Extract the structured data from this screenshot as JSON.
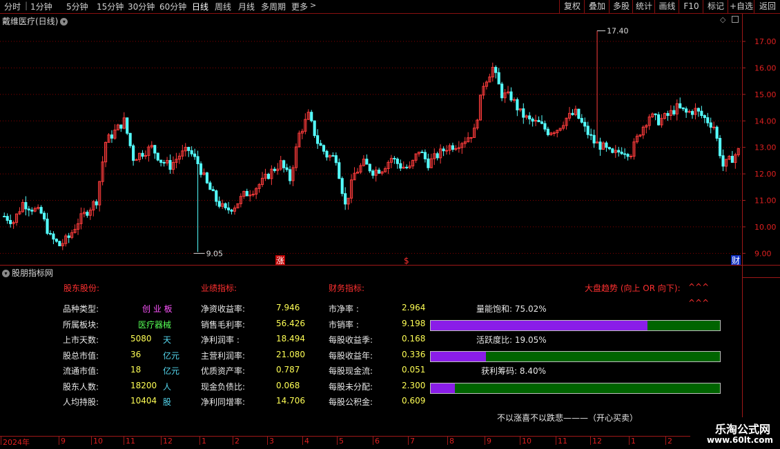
{
  "toolbar": {
    "periods": [
      "分时",
      "1分钟",
      "5分钟",
      "15分钟",
      "30分钟",
      "60分钟",
      "日线",
      "周线",
      "月线",
      "多周期",
      "更多"
    ],
    "active_period": "日线",
    "right_buttons": [
      "复权",
      "叠加",
      "多股",
      "统计",
      "画线",
      "F10",
      "标记",
      "+自选",
      "返回"
    ]
  },
  "chart": {
    "title": "戴维医疗(日线)",
    "price_axis": [
      "17.00",
      "16.00",
      "15.00",
      "14.00",
      "13.00",
      "12.00",
      "11.00",
      "10.00",
      "9.00"
    ],
    "high_marker": "17.40",
    "low_marker": "9.05",
    "event_markers": [
      "涨",
      "$",
      "财"
    ]
  },
  "chart_data": {
    "type": "candlestick",
    "ylim": [
      8.8,
      17.6
    ],
    "high": 17.4,
    "low": 9.05,
    "approx_close_path": [
      10.4,
      10.2,
      10.9,
      10.7,
      10.5,
      9.6,
      9.3,
      9.6,
      10.2,
      10.6,
      11.0,
      13.2,
      13.6,
      14.0,
      12.6,
      12.8,
      13.0,
      12.5,
      12.3,
      12.7,
      12.9,
      12.4,
      11.6,
      11.0,
      10.6,
      10.8,
      11.2,
      11.4,
      11.7,
      12.1,
      12.4,
      11.8,
      13.5,
      14.2,
      13.2,
      12.7,
      12.6,
      10.8,
      12.0,
      12.4,
      12.1,
      12.2,
      12.6,
      12.3,
      12.2,
      12.9,
      12.4,
      12.7,
      13.0,
      13.1,
      13.3,
      13.6,
      15.4,
      16.0,
      15.0,
      14.9,
      14.3,
      14.0,
      13.9,
      13.6,
      13.7,
      14.1,
      14.3,
      13.7,
      13.2,
      13.0,
      12.7,
      12.9,
      12.8,
      13.6,
      14.2,
      14.0,
      14.2,
      14.5,
      14.3,
      14.4,
      14.1,
      13.8,
      12.3,
      12.6,
      13.0
    ]
  },
  "panel": {
    "title": "股朋指标网",
    "col1_header": "股东股份:",
    "col2_header": "业绩指标:",
    "col3_header": "财务指标:",
    "trend_header": "大盘趋势 (向上 OR 向下):",
    "trend_arrows1": "^^^",
    "trend_arrows2": "^^^",
    "col1": [
      {
        "label": "品种类型:",
        "value": "创 业 板",
        "unit": ""
      },
      {
        "label": "所属板块:",
        "value": "医疗器械",
        "unit": ""
      },
      {
        "label": "上市天数:",
        "value": "5080",
        "unit": "天"
      },
      {
        "label": "股总市值:",
        "value": "36",
        "unit": "亿元"
      },
      {
        "label": "流通市值:",
        "value": "18",
        "unit": "亿元"
      },
      {
        "label": "股东人数:",
        "value": "18200",
        "unit": "人"
      },
      {
        "label": "人均持股:",
        "value": "10404",
        "unit": "股"
      }
    ],
    "col2": [
      {
        "label": "净资收益率:",
        "value": "7.946"
      },
      {
        "label": "销售毛利率:",
        "value": "56.426"
      },
      {
        "label": "净利润率  :",
        "value": "18.494"
      },
      {
        "label": "主营利润率:",
        "value": "21.080"
      },
      {
        "label": "优质资产率:",
        "value": "0.787"
      },
      {
        "label": "现金负债比:",
        "value": "0.068"
      },
      {
        "label": "净利同增率:",
        "value": "14.706"
      }
    ],
    "col3": [
      {
        "label": "市净率     :",
        "value": "2.964"
      },
      {
        "label": "市销率     :",
        "value": "9.198"
      },
      {
        "label": "每股收益季:",
        "value": "0.168"
      },
      {
        "label": "每股收益年:",
        "value": "0.336"
      },
      {
        "label": "每股现金流:",
        "value": "0.051"
      },
      {
        "label": "每股未分配:",
        "value": "2.300"
      },
      {
        "label": "每股公积金:",
        "value": "0.609"
      }
    ],
    "meters": [
      {
        "label": "量能饱和:  75.02%",
        "fraction": 0.7502
      },
      {
        "label": "活跃度比:  19.05%",
        "fraction": 0.1905
      },
      {
        "label": "获利筹码:  8.40%",
        "fraction": 0.084
      }
    ],
    "footer": "不以涨喜不以跌悲———（开心买卖）"
  },
  "date_axis": [
    "2024年",
    "9",
    "10",
    "11",
    "12",
    "1",
    "2",
    "3",
    "4",
    "5",
    "6",
    "7",
    "8",
    "9",
    "10",
    "11",
    "12",
    "1",
    "2"
  ],
  "watermark": {
    "line1": "乐淘公式网",
    "line2": "www.60lt.com"
  },
  "colors": {
    "up": "#ff3c3c",
    "down": "#54ffff",
    "grid": "#8a0000",
    "bar_fill": "#8a1de8",
    "bar_bg": "#006400"
  }
}
